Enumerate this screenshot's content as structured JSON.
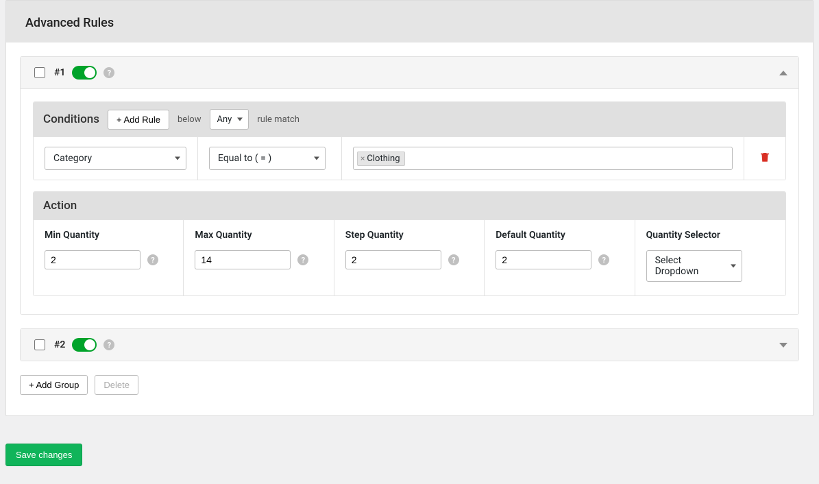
{
  "header": {
    "title": "Advanced Rules"
  },
  "rules": [
    {
      "label": "#1",
      "expanded": true,
      "enabled": true
    },
    {
      "label": "#2",
      "expanded": false,
      "enabled": true
    }
  ],
  "conditions": {
    "title": "Conditions",
    "add_rule": "+ Add Rule",
    "text_below": "below",
    "match_mode": "Any",
    "text_rule_match": "rule match",
    "row": {
      "field": "Category",
      "operator": "Equal to ( = )",
      "value_tag": "Clothing"
    }
  },
  "action": {
    "title": "Action",
    "cols": {
      "min_qty": {
        "label": "Min Quantity",
        "value": "2"
      },
      "max_qty": {
        "label": "Max Quantity",
        "value": "14"
      },
      "step_qty": {
        "label": "Step Quantity",
        "value": "2"
      },
      "default_qty": {
        "label": "Default Quantity",
        "value": "2"
      },
      "qty_selector": {
        "label": "Quantity Selector",
        "value": "Select Dropdown"
      }
    }
  },
  "footer": {
    "add_group": "+ Add Group",
    "delete": "Delete"
  },
  "save": {
    "label": "Save changes"
  },
  "icons": {
    "help": "?",
    "tag_x": "×"
  }
}
